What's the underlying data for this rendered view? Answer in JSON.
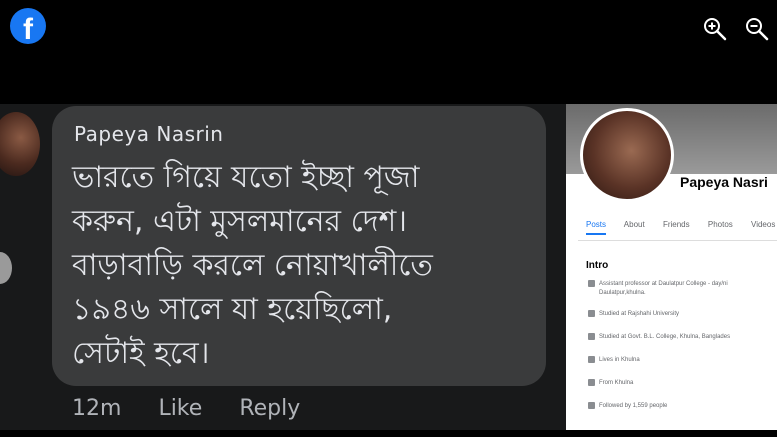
{
  "viewer": {
    "logo_letter": "f",
    "zoom_in_label": "zoom in",
    "zoom_out_label": "zoom out"
  },
  "comment": {
    "author": "Papeya Nasrin",
    "lines": [
      "ভারতে গিয়ে যতো ইচ্ছা পূজা",
      "করুন, এটা মুসলমানের দেশ।",
      "বাড়াবাড়ি করলে নোয়াখালীতে",
      "১৯৪৬ সালে যা হয়েছিলো,",
      "সেটাই হবে।"
    ],
    "time": "12m",
    "like": "Like",
    "reply": "Reply"
  },
  "profile": {
    "name": "Papeya Nasri",
    "tabs": [
      "Posts",
      "About",
      "Friends",
      "Photos",
      "Videos"
    ],
    "intro_title": "Intro",
    "intro_items": [
      "Assistant professor at Daulatpur College - day/ni",
      "Daulatpur,khulna.",
      "Studied at Rajshahi University",
      "Studied at Govt. B.L. College, Khulna, Banglades",
      "Lives in Khulna",
      "From Khulna",
      "Followed by 1,559 people"
    ]
  },
  "colors": {
    "facebook_blue": "#1877f2",
    "bubble_bg": "#3a3b3c",
    "text_primary": "#e4e6eb",
    "text_secondary": "#b0b3b8"
  }
}
